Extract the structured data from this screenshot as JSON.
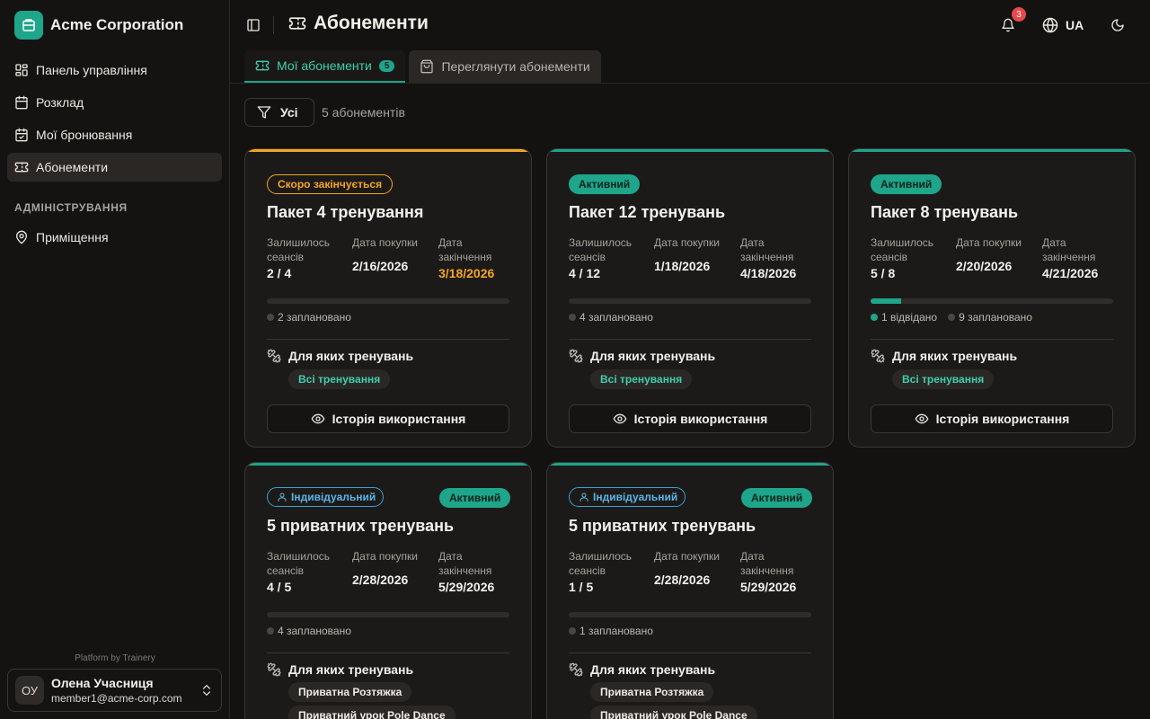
{
  "brand": {
    "name": "Acme Corporation"
  },
  "sidebar": {
    "items": [
      {
        "label": "Панель управління",
        "icon": "dashboard-icon"
      },
      {
        "label": "Розклад",
        "icon": "calendar-icon"
      },
      {
        "label": "Мої бронювання",
        "icon": "calendar-check-icon"
      },
      {
        "label": "Абонементи",
        "icon": "ticket-icon",
        "active": true
      }
    ],
    "admin_section": "АДМІНІСТРУВАННЯ",
    "admin_items": [
      {
        "label": "Приміщення",
        "icon": "map-pin-icon"
      }
    ],
    "platform": "Platform by Trainery",
    "user": {
      "initials": "ОУ",
      "name": "Олена Учасниця",
      "email": "member1@acme-corp.com"
    }
  },
  "header": {
    "title": "Абонементи",
    "notifications": "3",
    "language": "UA"
  },
  "tabs": [
    {
      "label": "Мої абонементи",
      "count": "5",
      "active": true
    },
    {
      "label": "Переглянути абонементи",
      "active": false
    }
  ],
  "filter": {
    "label": "Усі",
    "count_text": "5 абонементів"
  },
  "labels": {
    "remaining": "Залишилось сеансів",
    "purchased": "Дата покупки",
    "expires": "Дата закінчення",
    "for_which": "Для яких тренувань",
    "history": "Історія використання"
  },
  "colors": {
    "accent": "#1ea58a",
    "warning": "#f5a524",
    "info": "#3aa0d8"
  },
  "cards": [
    {
      "status": "Скоро закінчується",
      "title": "Пакет 4 тренування",
      "remaining": "2 / 4",
      "purchased": "2/16/2026",
      "expires": "3/18/2026",
      "used_fraction": 0,
      "legend": [
        "2 заплановано"
      ],
      "tags": [
        "Всі тренування"
      ]
    },
    {
      "status": "Активний",
      "title": "Пакет 12 тренувань",
      "remaining": "4 / 12",
      "purchased": "1/18/2026",
      "expires": "4/18/2026",
      "used_fraction": 0,
      "legend": [
        "4 заплановано"
      ],
      "tags": [
        "Всі тренування"
      ]
    },
    {
      "status": "Активний",
      "title": "Пакет 8 тренувань",
      "remaining": "5 / 8",
      "purchased": "2/20/2026",
      "expires": "4/21/2026",
      "used_fraction": 0.125,
      "legend": [
        "1 відвідано",
        "9 заплановано"
      ],
      "tags": [
        "Всі тренування"
      ]
    },
    {
      "type": "Індивідуальний",
      "status": "Активний",
      "title": "5 приватних тренувань",
      "remaining": "4 / 5",
      "purchased": "2/28/2026",
      "expires": "5/29/2026",
      "used_fraction": 0,
      "legend": [
        "4 заплановано"
      ],
      "tags": [
        "Приватна Розтяжка",
        "Приватний урок Pole Dance"
      ]
    },
    {
      "type": "Індивідуальний",
      "status": "Активний",
      "title": "5 приватних тренувань",
      "remaining": "1 / 5",
      "purchased": "2/28/2026",
      "expires": "5/29/2026",
      "used_fraction": 0,
      "legend": [
        "1 заплановано"
      ],
      "tags": [
        "Приватна Розтяжка",
        "Приватний урок Pole Dance"
      ]
    }
  ]
}
